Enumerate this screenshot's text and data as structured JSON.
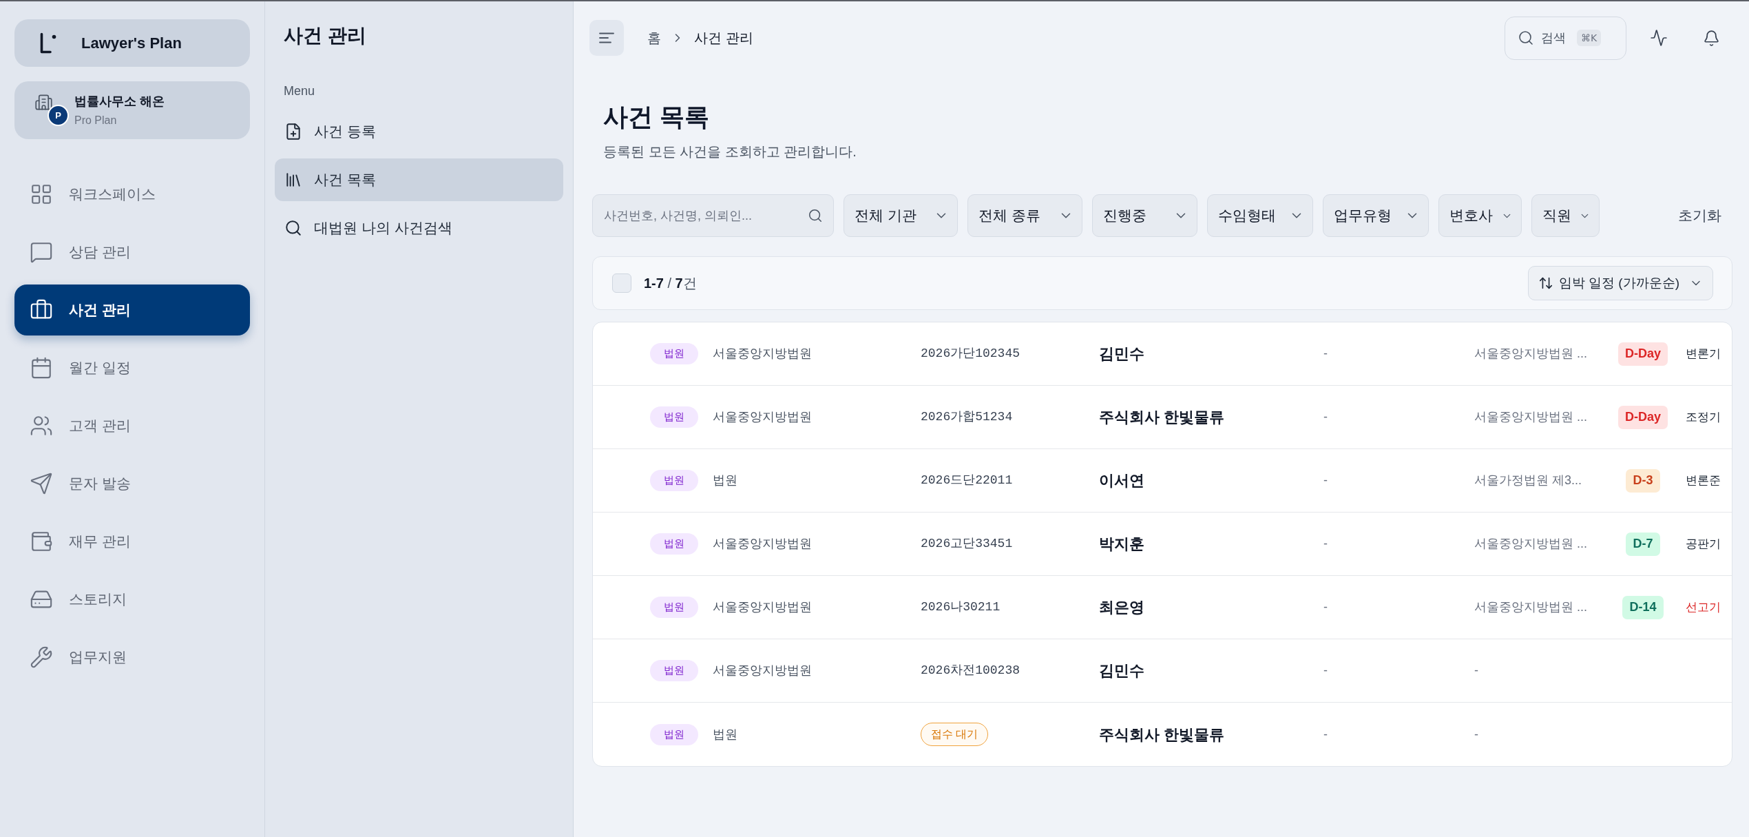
{
  "sidebar": {
    "brand": "Lawyer's Plan",
    "org": {
      "name": "법률사무소 해온",
      "plan": "Pro Plan",
      "badge": "P"
    },
    "items": [
      {
        "label": "워크스페이스",
        "selected": false
      },
      {
        "label": "상담 관리",
        "selected": false
      },
      {
        "label": "사건 관리",
        "selected": true
      },
      {
        "label": "월간 일정",
        "selected": false
      },
      {
        "label": "고객 관리",
        "selected": false
      },
      {
        "label": "문자 발송",
        "selected": false
      },
      {
        "label": "재무 관리",
        "selected": false
      },
      {
        "label": "스토리지",
        "selected": false
      },
      {
        "label": "업무지원",
        "selected": false
      }
    ]
  },
  "submenu": {
    "title": "사건 관리",
    "section": "Menu",
    "items": [
      {
        "label": "사건 등록",
        "selected": false
      },
      {
        "label": "사건 목록",
        "selected": true
      },
      {
        "label": "대법원 나의 사건검색",
        "selected": false
      }
    ]
  },
  "header": {
    "breadcrumb": [
      "홈",
      "사건 관리"
    ],
    "search": {
      "label": "검색",
      "shortcut": "⌘K"
    }
  },
  "page": {
    "title": "사건 목록",
    "subtitle": "등록된 모든 사건을 조회하고 관리합니다."
  },
  "filters": {
    "search": {
      "placeholder": "사건번호, 사건명, 의뢰인..."
    },
    "dropdowns": [
      "전체 기관",
      "전체 종류",
      "진행중",
      "수임형태",
      "업무유형",
      "변호사",
      "직원"
    ],
    "reset": "초기화"
  },
  "list_bar": {
    "select_all": {
      "checked": false
    },
    "count": "**1-7** / **7**건",
    "sort": "임박 일정 (가까운순)"
  },
  "rows": [
    {
      "tag": "법원",
      "court": "서울중앙지방법원",
      "case_number": {
        "kind": "number",
        "text": "2026가단102345"
      },
      "client": "김민수",
      "column_5": "-",
      "column_6": "서울중앙지방법원 ...",
      "d_day": {
        "text": "D-Day",
        "kind": "urgent"
      },
      "column_8": {
        "text": "변론기",
        "alert": false
      }
    },
    {
      "tag": "법원",
      "court": "서울중앙지방법원",
      "case_number": {
        "kind": "number",
        "text": "2026가합51234"
      },
      "client": "주식회사 한빛물류",
      "column_5": "-",
      "column_6": "서울중앙지방법원 ...",
      "d_day": {
        "text": "D-Day",
        "kind": "urgent"
      },
      "column_8": {
        "text": "조정기",
        "alert": false
      }
    },
    {
      "tag": "법원",
      "court": "법원",
      "case_number": {
        "kind": "number",
        "text": "2026드단22011"
      },
      "client": "이서연",
      "column_5": "-",
      "column_6": "서울가정법원 제3...",
      "d_day": {
        "text": "D-3",
        "kind": "soon"
      },
      "column_8": {
        "text": "변론준",
        "alert": false
      }
    },
    {
      "tag": "법원",
      "court": "서울중앙지방법원",
      "case_number": {
        "kind": "number",
        "text": "2026고단33451"
      },
      "client": "박지훈",
      "column_5": "-",
      "column_6": "서울중앙지방법원 ...",
      "d_day": {
        "text": "D-7",
        "kind": "later"
      },
      "column_8": {
        "text": "공판기",
        "alert": false
      }
    },
    {
      "tag": "법원",
      "court": "서울중앙지방법원",
      "case_number": {
        "kind": "number",
        "text": "2026나30211"
      },
      "client": "최은영",
      "column_5": "-",
      "column_6": "서울중앙지방법원 ...",
      "d_day": {
        "text": "D-14",
        "kind": "later"
      },
      "column_8": {
        "text": "선고기",
        "alert": true
      }
    },
    {
      "tag": "법원",
      "court": "서울중앙지방법원",
      "case_number": {
        "kind": "number",
        "text": "2026차전100238"
      },
      "client": "김민수",
      "column_5": "-",
      "column_6": "-"
    },
    {
      "tag": "법원",
      "court": "법원",
      "case_number": {
        "kind": "status",
        "text": "접수 대기"
      },
      "client": "주식회사 한빛물류",
      "column_5": "-",
      "column_6": "-"
    }
  ]
}
